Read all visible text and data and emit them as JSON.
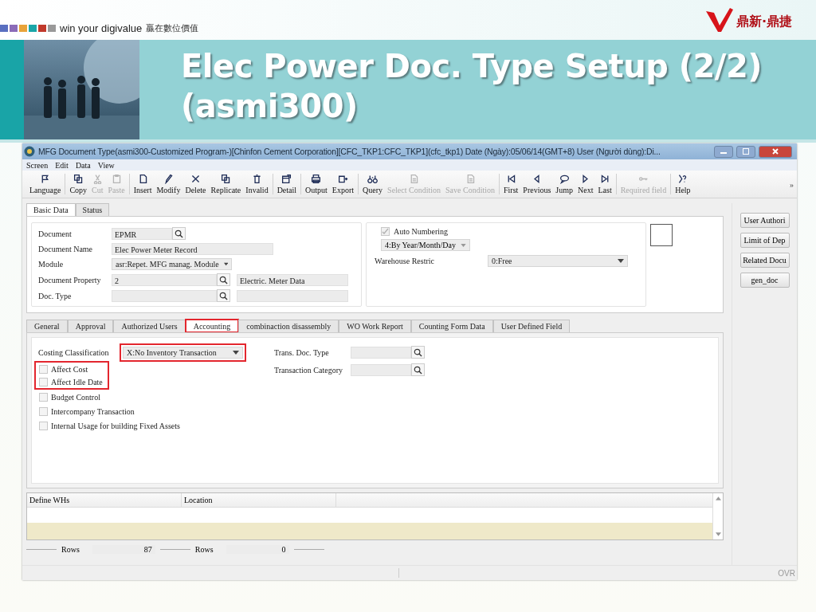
{
  "slide": {
    "tagline": "win your digivalue",
    "tagline_cn": "贏在數位價值",
    "brand": "鼎新·鼎捷",
    "title_lines": [
      "Elec Power Doc. Type Setup (2/2)",
      "(asmi300)"
    ]
  },
  "window": {
    "title": "MFG Document Type(asmi300-Customized Program-)[Chinfon Cement Corporation][CFC_TKP1:CFC_TKP1](cfc_tkp1)  Date (Ngày):05/06/14(GMT+8)  User (Người dùng):Di..."
  },
  "menu": [
    "Screen",
    "Edit",
    "Data",
    "View"
  ],
  "toolbar": [
    [
      {
        "label": "Language",
        "disabled": false
      }
    ],
    [
      {
        "label": "Copy",
        "disabled": false
      },
      {
        "label": "Cut",
        "disabled": true
      },
      {
        "label": "Paste",
        "disabled": true
      }
    ],
    [
      {
        "label": "Insert",
        "disabled": false
      },
      {
        "label": "Modify",
        "disabled": false
      },
      {
        "label": "Delete",
        "disabled": false
      },
      {
        "label": "Replicate",
        "disabled": false
      },
      {
        "label": "Invalid",
        "disabled": false
      }
    ],
    [
      {
        "label": "Detail",
        "disabled": false
      }
    ],
    [
      {
        "label": "Output",
        "disabled": false
      },
      {
        "label": "Export",
        "disabled": false
      }
    ],
    [
      {
        "label": "Query",
        "disabled": false
      },
      {
        "label": "Select Condition",
        "disabled": true
      },
      {
        "label": "Save Condition",
        "disabled": true
      }
    ],
    [
      {
        "label": "First",
        "disabled": false
      },
      {
        "label": "Previous",
        "disabled": false
      },
      {
        "label": "Jump",
        "disabled": false
      },
      {
        "label": "Next",
        "disabled": false
      },
      {
        "label": "Last",
        "disabled": false
      }
    ],
    [
      {
        "label": "Required field",
        "disabled": true
      }
    ],
    [
      {
        "label": "Help",
        "disabled": false
      }
    ]
  ],
  "toolbar_overflow": "»",
  "top_tabs": [
    {
      "label": "Basic Data",
      "selected": true
    },
    {
      "label": "Status",
      "selected": false
    }
  ],
  "header_fields": [
    {
      "kind": "lookup",
      "label": "Document",
      "value": "EPMR"
    },
    {
      "kind": "text",
      "label": "Document Name",
      "value": "Elec Power Meter Record"
    },
    {
      "kind": "select",
      "label": "Module",
      "value": "asr:Repet. MFG manag. Module"
    },
    {
      "kind": "lookup_desc",
      "label": "Document Property",
      "value": "2",
      "description": "Electric. Meter Data"
    },
    {
      "kind": "lookup_desc",
      "label": "Doc. Type"
    }
  ],
  "numbering": {
    "label": "Auto Numbering",
    "checked": true,
    "disabled": true,
    "format": "4:By Year/Month/Day"
  },
  "warehouse": {
    "label": "Warehouse Restric",
    "value": "0:Free"
  },
  "side_buttons": [
    "User Authori",
    "Limit of Dep",
    "Related Docu",
    "gen_doc"
  ],
  "detail_tabs": [
    {
      "label": "General",
      "selected": false,
      "highlighted": false
    },
    {
      "label": "Approval",
      "selected": false,
      "highlighted": false
    },
    {
      "label": "Authorized Users",
      "selected": false,
      "highlighted": false
    },
    {
      "label": "Accounting",
      "selected": true,
      "highlighted": true
    },
    {
      "label": "combinaction disassembly",
      "selected": false,
      "highlighted": false
    },
    {
      "label": "WO Work Report",
      "selected": false,
      "highlighted": false
    },
    {
      "label": "Counting Form Data",
      "selected": false,
      "highlighted": false
    },
    {
      "label": "User Defined Field",
      "selected": false,
      "highlighted": false
    }
  ],
  "accounting": {
    "costing": {
      "label": "Costing Classification",
      "value": "X:No Inventory Transaction",
      "highlighted": true
    },
    "lookups": [
      {
        "label": "Trans. Doc. Type"
      },
      {
        "label": "Transaction Category"
      }
    ],
    "checkboxes": [
      {
        "label": "Affect Cost",
        "checked": false,
        "highlighted": true
      },
      {
        "label": "Affect Idle Date",
        "checked": false,
        "highlighted": true
      },
      {
        "label": "Budget Control",
        "checked": false,
        "highlighted": false
      },
      {
        "label": "Intercompany Transaction",
        "checked": false,
        "highlighted": false
      },
      {
        "label": "Internal Usage for building Fixed Assets",
        "checked": false,
        "highlighted": false
      }
    ]
  },
  "grid": {
    "columns": [
      "Define WHs",
      "Location"
    ]
  },
  "counters": [
    {
      "label": "Rows",
      "value": "87"
    },
    {
      "label": "Rows",
      "value": "0"
    }
  ],
  "status_bar": {
    "mode": "OVR"
  }
}
